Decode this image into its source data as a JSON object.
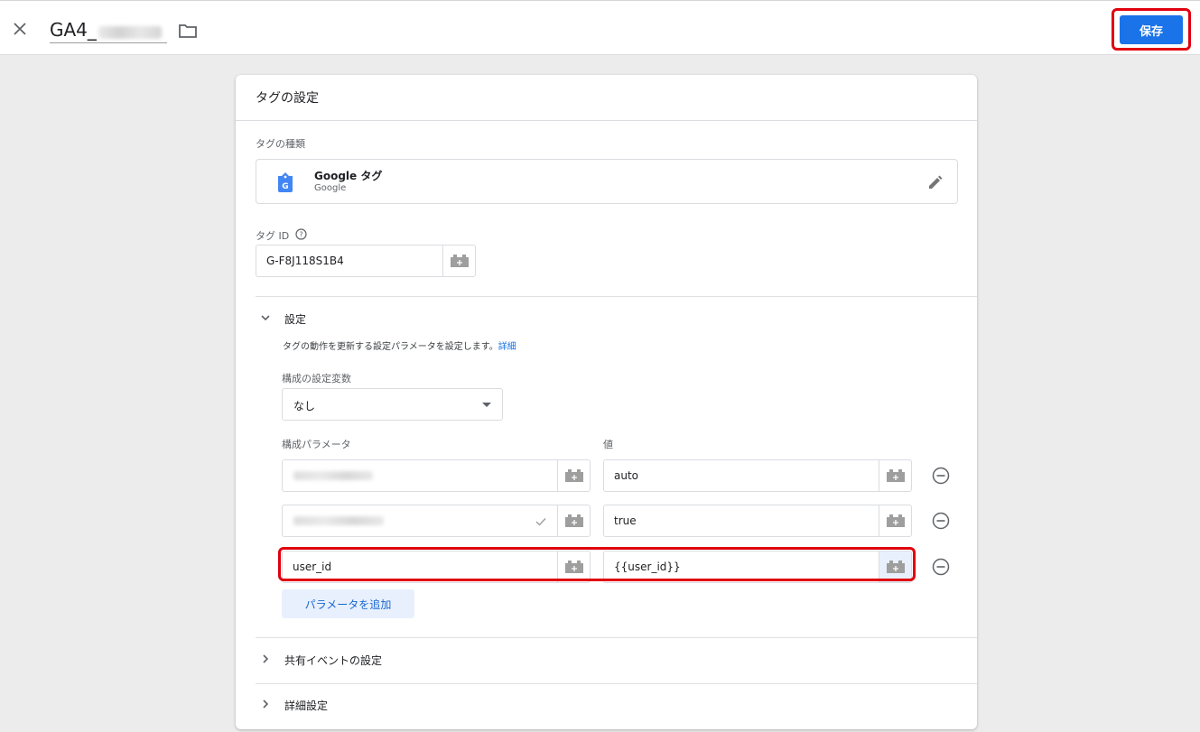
{
  "header": {
    "title": "GA4_",
    "save_label": "保存"
  },
  "card": {
    "title": "タグの設定",
    "tag_type_label": "タグの種類",
    "tag_type_name": "Google タグ",
    "tag_type_vendor": "Google",
    "tag_id_label": "タグ ID",
    "tag_id_value": "G-F8J118S1B4"
  },
  "settings": {
    "section_title": "設定",
    "description": "タグの動作を更新する設定パラメータを設定します。",
    "details_link": "詳細",
    "config_var_label": "構成の設定変数",
    "config_var_value": "なし",
    "param_col_label": "構成パラメータ",
    "value_col_label": "値",
    "rows": [
      {
        "param": "",
        "value": "auto"
      },
      {
        "param": "",
        "value": "true"
      },
      {
        "param": "user_id",
        "value": "{{user_id}}"
      }
    ],
    "add_param_label": "パラメータを追加"
  },
  "sections": {
    "shared_events": "共有イベントの設定",
    "advanced": "詳細設定"
  },
  "colors": {
    "accent": "#1a73e8",
    "highlight": "#e0000e"
  }
}
